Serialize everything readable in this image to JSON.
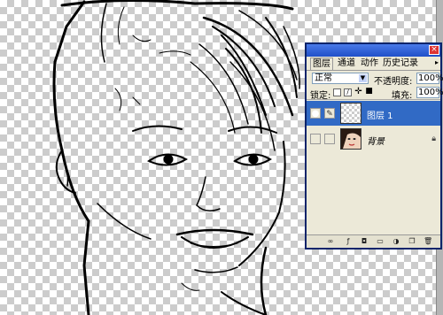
{
  "layers_panel": {
    "tabs": [
      {
        "label": "图层",
        "active": true
      },
      {
        "label": "通道",
        "active": false
      },
      {
        "label": "动作",
        "active": false
      },
      {
        "label": "历史记录",
        "active": false
      }
    ],
    "close_glyph": "×",
    "menu_glyph": "▸",
    "blend_mode": "正常",
    "opacity_label": "不透明度:",
    "opacity_value": "100%",
    "lock_label": "锁定:",
    "fill_label": "填充:",
    "fill_value": "100%",
    "layers": [
      {
        "name": "图层 1",
        "visible": true,
        "selected": true,
        "thumbnail": "transparent-checker"
      },
      {
        "name": "背景",
        "visible": false,
        "selected": false,
        "locked": true,
        "thumbnail": "portrait-photo"
      }
    ],
    "footer_icons": [
      "link-layers-icon",
      "layer-style-icon",
      "layer-mask-icon",
      "new-group-icon",
      "adjustment-layer-icon",
      "new-layer-icon",
      "delete-layer-icon"
    ]
  },
  "colors": {
    "selection": "#316ac5",
    "panel_bg": "#ece9d8",
    "titlebar": "#1f4fc8"
  }
}
